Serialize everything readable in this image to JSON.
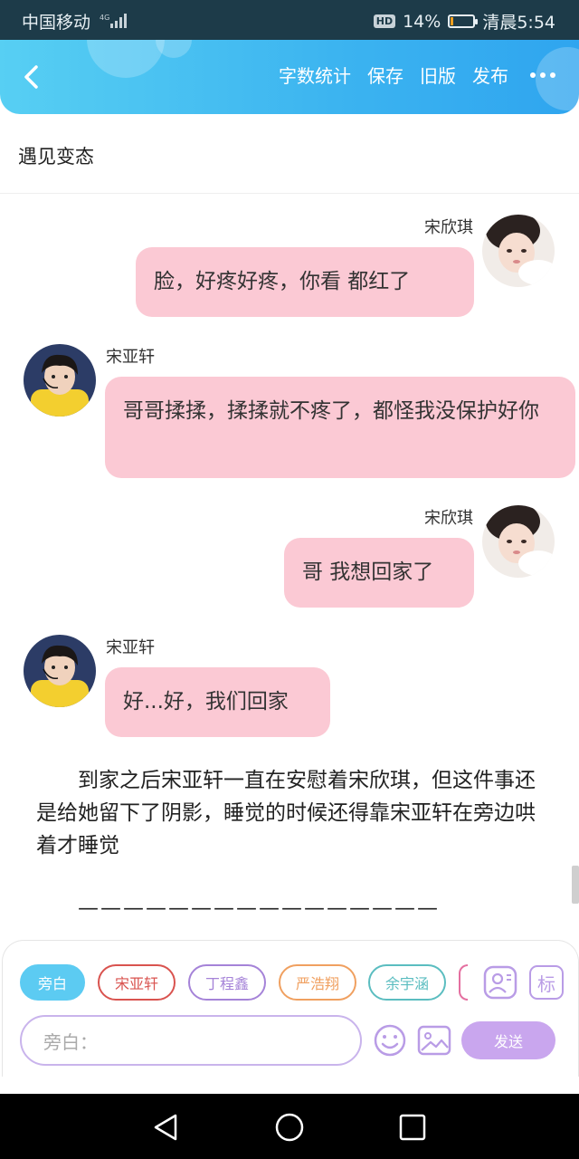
{
  "status_bar": {
    "carrier": "中国移动",
    "network": "4G",
    "hd_badge": "HD",
    "battery": "14%",
    "battery_level": 0.14,
    "time": "清晨5:54"
  },
  "header": {
    "actions": [
      "字数统计",
      "保存",
      "旧版",
      "发布"
    ],
    "icons": [
      "back-icon",
      "more-icon"
    ]
  },
  "document": {
    "title": "遇见变态"
  },
  "chat": {
    "messages": [
      {
        "speaker": "宋欣琪",
        "side": "right",
        "text": "脸，好疼好疼，你看 都红了"
      },
      {
        "speaker": "宋亚轩",
        "side": "left",
        "text": "哥哥揉揉，揉揉就不疼了，都怪我没保护好你"
      },
      {
        "speaker": "宋欣琪",
        "side": "right",
        "text": "哥 我想回家了"
      },
      {
        "speaker": "宋亚轩",
        "side": "left",
        "text": "好...好，我们回家"
      }
    ],
    "narration": "到家之后宋亚轩一直在安慰着宋欣琪，但这件事还是给她留下了阴影，睡觉的时候还得靠宋亚轩在旁边哄着才睡觉",
    "separator": "————————————————"
  },
  "composer": {
    "role_chips": [
      {
        "label": "旁白",
        "color": "#5ccbf2",
        "active": true
      },
      {
        "label": "宋亚轩",
        "color": "#d9534f",
        "active": false
      },
      {
        "label": "丁程鑫",
        "color": "#a583d8",
        "active": false
      },
      {
        "label": "严浩翔",
        "color": "#f0a060",
        "active": false
      },
      {
        "label": "余宇涵",
        "color": "#5bbdc0",
        "active": false
      }
    ],
    "tag_icon_label": "标",
    "input_placeholder": "旁白：",
    "send_label": "发送",
    "accent": "#c9a6ee"
  },
  "nav_bar": {
    "icons": [
      "back-triangle-icon",
      "home-circle-icon",
      "recents-square-icon"
    ]
  }
}
